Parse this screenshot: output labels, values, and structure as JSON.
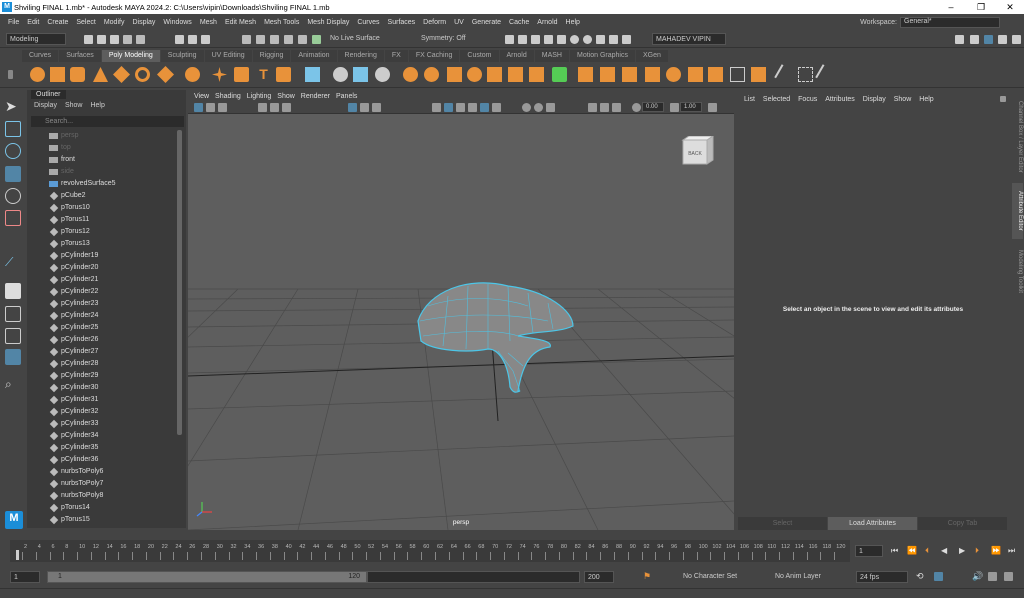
{
  "window": {
    "title": "Shviling FINAL 1.mb* - Autodesk MAYA 2024.2: C:\\Users\\vipin\\Downloads\\Shviling FINAL 1.mb",
    "minimize": "–",
    "maximize": "❐",
    "close": "✕"
  },
  "menubar": [
    "File",
    "Edit",
    "Create",
    "Select",
    "Modify",
    "Display",
    "Windows",
    "Mesh",
    "Edit Mesh",
    "Mesh Tools",
    "Mesh Display",
    "Curves",
    "Surfaces",
    "Deform",
    "UV",
    "Generate",
    "Cache",
    "Arnold",
    "Help"
  ],
  "workspace": {
    "label": "Workspace:",
    "value": "General*"
  },
  "statusline": {
    "mode": "Modeling",
    "live_surface": "No Live Surface",
    "symmetry": "Symmetry: Off",
    "user": "MAHADEV VIPIN"
  },
  "shelf_tabs": [
    "Curves",
    "Surfaces",
    "Poly Modeling",
    "Sculpting",
    "UV Editing",
    "Rigging",
    "Animation",
    "Rendering",
    "FX",
    "FX Caching",
    "Custom",
    "Arnold",
    "MASH",
    "Motion Graphics",
    "XGen"
  ],
  "shelf_active": "Poly Modeling",
  "outliner": {
    "tab": "Outliner",
    "menu": [
      "Display",
      "Show",
      "Help"
    ],
    "search_placeholder": "Search...",
    "items": [
      {
        "label": "persp",
        "type": "camera",
        "dim": true
      },
      {
        "label": "top",
        "type": "camera",
        "dim": true
      },
      {
        "label": "front",
        "type": "camera",
        "dim": false
      },
      {
        "label": "side",
        "type": "camera",
        "dim": true
      },
      {
        "label": "revolvedSurface5",
        "type": "surface",
        "dim": false
      },
      {
        "label": "pCube2",
        "type": "mesh",
        "dim": false
      },
      {
        "label": "pTorus10",
        "type": "mesh",
        "dim": false
      },
      {
        "label": "pTorus11",
        "type": "mesh",
        "dim": false
      },
      {
        "label": "pTorus12",
        "type": "mesh",
        "dim": false
      },
      {
        "label": "pTorus13",
        "type": "mesh",
        "dim": false
      },
      {
        "label": "pCylinder19",
        "type": "mesh",
        "dim": false
      },
      {
        "label": "pCylinder20",
        "type": "mesh",
        "dim": false
      },
      {
        "label": "pCylinder21",
        "type": "mesh",
        "dim": false
      },
      {
        "label": "pCylinder22",
        "type": "mesh",
        "dim": false
      },
      {
        "label": "pCylinder23",
        "type": "mesh",
        "dim": false
      },
      {
        "label": "pCylinder24",
        "type": "mesh",
        "dim": false
      },
      {
        "label": "pCylinder25",
        "type": "mesh",
        "dim": false
      },
      {
        "label": "pCylinder26",
        "type": "mesh",
        "dim": false
      },
      {
        "label": "pCylinder27",
        "type": "mesh",
        "dim": false
      },
      {
        "label": "pCylinder28",
        "type": "mesh",
        "dim": false
      },
      {
        "label": "pCylinder29",
        "type": "mesh",
        "dim": false
      },
      {
        "label": "pCylinder30",
        "type": "mesh",
        "dim": false
      },
      {
        "label": "pCylinder31",
        "type": "mesh",
        "dim": false
      },
      {
        "label": "pCylinder32",
        "type": "mesh",
        "dim": false
      },
      {
        "label": "pCylinder33",
        "type": "mesh",
        "dim": false
      },
      {
        "label": "pCylinder34",
        "type": "mesh",
        "dim": false
      },
      {
        "label": "pCylinder35",
        "type": "mesh",
        "dim": false
      },
      {
        "label": "pCylinder36",
        "type": "mesh",
        "dim": false
      },
      {
        "label": "nurbsToPoly6",
        "type": "mesh",
        "dim": false
      },
      {
        "label": "nurbsToPoly7",
        "type": "mesh",
        "dim": false
      },
      {
        "label": "nurbsToPoly8",
        "type": "mesh",
        "dim": false
      },
      {
        "label": "pTorus14",
        "type": "mesh",
        "dim": false
      },
      {
        "label": "pTorus15",
        "type": "mesh",
        "dim": false
      }
    ]
  },
  "viewport": {
    "menu": [
      "View",
      "Shading",
      "Lighting",
      "Show",
      "Renderer",
      "Panels"
    ],
    "camera": "persp",
    "near_value": "0.00",
    "far_value": "1.00",
    "viewcube_face": "BACK"
  },
  "attribute_editor": {
    "menu": [
      "List",
      "Selected",
      "Focus",
      "Attributes",
      "Display",
      "Show",
      "Help"
    ],
    "message": "Select an object in the scene to view and edit its attributes",
    "buttons": [
      "Select",
      "Load Attributes",
      "Copy Tab"
    ]
  },
  "side_tabs": [
    "Channel Box / Layer Editor",
    "Attribute Editor",
    "Modeling Toolkit"
  ],
  "timeline": {
    "ticks": [
      "2",
      "4",
      "6",
      "8",
      "10",
      "12",
      "14",
      "16",
      "18",
      "20",
      "22",
      "24",
      "26",
      "28",
      "30",
      "32",
      "34",
      "36",
      "38",
      "40",
      "42",
      "44",
      "46",
      "48",
      "50",
      "52",
      "54",
      "56",
      "58",
      "60",
      "62",
      "64",
      "66",
      "68",
      "70",
      "72",
      "74",
      "76",
      "78",
      "80",
      "82",
      "84",
      "86",
      "88",
      "90",
      "92",
      "94",
      "96",
      "98",
      "100",
      "102",
      "104",
      "106",
      "108",
      "110",
      "112",
      "114",
      "116",
      "118",
      "120"
    ],
    "current_frame": "1"
  },
  "range": {
    "start": "1",
    "inner_start": "1",
    "inner_end": "120",
    "end": "120",
    "outer_end": "200",
    "character_set": "No Character Set",
    "anim_layer": "No Anim Layer",
    "fps": "24 fps"
  },
  "logo": "M",
  "colors": {
    "accent": "#1b8ed8",
    "selected_tool": "#5285a6",
    "mesh_wire": "#4cc6e8"
  }
}
